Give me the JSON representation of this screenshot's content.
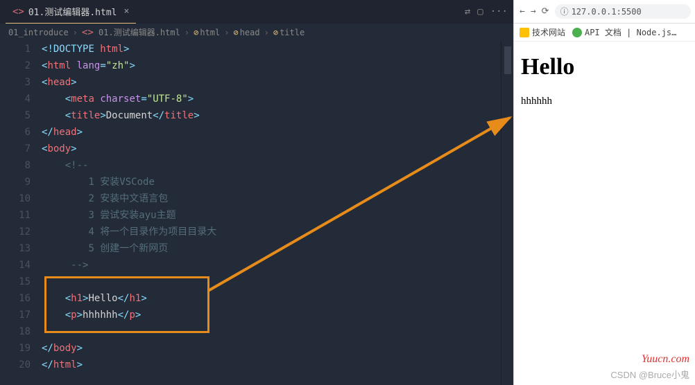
{
  "tab": {
    "icon": "<>",
    "label": "01.测试编辑器.html",
    "close": "×"
  },
  "tabbar_icons": {
    "compare": "⇄",
    "split": "▢",
    "more": "···"
  },
  "breadcrumb": [
    "01_introduce",
    "01.测试编辑器.html",
    "html",
    "head",
    "title"
  ],
  "bc_symbol": "⊘",
  "browser": {
    "nav": {
      "back": "←",
      "forward": "→",
      "reload": "⟳"
    },
    "url_info": "ⓘ",
    "url": "127.0.0.1:5500",
    "bookmarks": [
      {
        "icon": "y",
        "label": "技术网站"
      },
      {
        "icon": "g",
        "label": "API 文档 | Node.js…"
      }
    ],
    "h1": "Hello",
    "p": "hhhhhh"
  },
  "code": {
    "lines": [
      {
        "n": 1,
        "seg": [
          [
            "t-punc",
            "<"
          ],
          [
            "t-doc",
            "!DOCTYPE "
          ],
          [
            "t-tag",
            "html"
          ],
          [
            "t-punc",
            ">"
          ]
        ]
      },
      {
        "n": 2,
        "seg": [
          [
            "t-punc",
            "<"
          ],
          [
            "t-tag",
            "html "
          ],
          [
            "t-attr",
            "lang"
          ],
          [
            "t-punc",
            "="
          ],
          [
            "t-str",
            "\"zh\""
          ],
          [
            "t-punc",
            ">"
          ]
        ]
      },
      {
        "n": 3,
        "seg": [
          [
            "t-punc",
            "<"
          ],
          [
            "t-tag",
            "head"
          ],
          [
            "t-punc",
            ">"
          ]
        ]
      },
      {
        "n": 4,
        "pad": "    ",
        "seg": [
          [
            "t-punc",
            "<"
          ],
          [
            "t-tag",
            "meta "
          ],
          [
            "t-attr",
            "charset"
          ],
          [
            "t-punc",
            "="
          ],
          [
            "t-str",
            "\"UTF-8\""
          ],
          [
            "t-punc",
            ">"
          ]
        ]
      },
      {
        "n": 5,
        "pad": "    ",
        "seg": [
          [
            "t-punc",
            "<"
          ],
          [
            "t-tag",
            "title"
          ],
          [
            "t-punc",
            ">"
          ],
          [
            "t-txt",
            "Document"
          ],
          [
            "t-punc",
            "</"
          ],
          [
            "t-tag",
            "title"
          ],
          [
            "t-punc",
            ">"
          ]
        ]
      },
      {
        "n": 6,
        "seg": [
          [
            "t-punc",
            "</"
          ],
          [
            "t-tag",
            "head"
          ],
          [
            "t-punc",
            ">"
          ]
        ]
      },
      {
        "n": 7,
        "seg": [
          [
            "t-punc",
            "<"
          ],
          [
            "t-tag",
            "body"
          ],
          [
            "t-punc",
            ">"
          ]
        ]
      },
      {
        "n": 8,
        "pad": "    ",
        "seg": [
          [
            "t-com",
            "<!--"
          ]
        ]
      },
      {
        "n": 9,
        "pad": "        ",
        "seg": [
          [
            "t-com",
            "1 安装VSCode"
          ]
        ]
      },
      {
        "n": 10,
        "pad": "        ",
        "seg": [
          [
            "t-com",
            "2 安装中文语言包"
          ]
        ]
      },
      {
        "n": 11,
        "pad": "        ",
        "seg": [
          [
            "t-com",
            "3 尝试安装ayu主题"
          ]
        ]
      },
      {
        "n": 12,
        "pad": "        ",
        "seg": [
          [
            "t-com",
            "4 将一个目录作为项目目录大"
          ]
        ]
      },
      {
        "n": 13,
        "pad": "        ",
        "seg": [
          [
            "t-com",
            "5 创建一个新网页"
          ]
        ]
      },
      {
        "n": 14,
        "pad": "     ",
        "seg": [
          [
            "t-com",
            "-->"
          ]
        ]
      },
      {
        "n": 15,
        "seg": []
      },
      {
        "n": 16,
        "pad": "    ",
        "seg": [
          [
            "t-punc",
            "<"
          ],
          [
            "t-tag",
            "h1"
          ],
          [
            "t-punc",
            ">"
          ],
          [
            "t-txt",
            "Hello"
          ],
          [
            "t-punc",
            "</"
          ],
          [
            "t-tag",
            "h1"
          ],
          [
            "t-punc",
            ">"
          ]
        ]
      },
      {
        "n": 17,
        "pad": "    ",
        "seg": [
          [
            "t-punc",
            "<"
          ],
          [
            "t-tag",
            "p"
          ],
          [
            "t-punc",
            ">"
          ],
          [
            "t-txt",
            "hhhhhh"
          ],
          [
            "t-punc",
            "</"
          ],
          [
            "t-tag",
            "p"
          ],
          [
            "t-punc",
            ">"
          ]
        ]
      },
      {
        "n": 18,
        "seg": []
      },
      {
        "n": 19,
        "seg": [
          [
            "t-punc",
            "</"
          ],
          [
            "t-tag",
            "body"
          ],
          [
            "t-punc",
            ">"
          ]
        ]
      },
      {
        "n": 20,
        "seg": [
          [
            "t-punc",
            "</"
          ],
          [
            "t-tag",
            "html"
          ],
          [
            "t-punc",
            ">"
          ]
        ]
      }
    ]
  },
  "watermarks": {
    "w1": "Yuucn.com",
    "w2": "CSDN @Bruce小鬼"
  }
}
